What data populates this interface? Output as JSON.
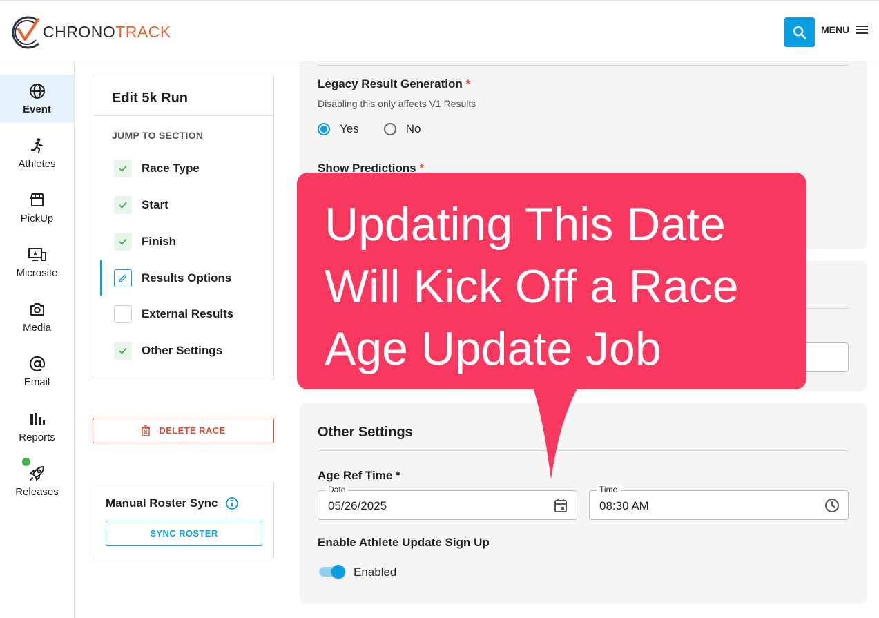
{
  "brand": {
    "chrono": "CHRONO",
    "track": "TRACK",
    "accent": "#e8642a"
  },
  "header": {
    "menu_label": "MENU"
  },
  "colors": {
    "primary": "#0a9fe2",
    "danger": "#e04a3a",
    "success": "#3cb54a",
    "callout": "#f8385f"
  },
  "sidebar": {
    "items": [
      {
        "label": "Event",
        "icon": "globe-icon",
        "active": true
      },
      {
        "label": "Athletes",
        "icon": "runner-icon"
      },
      {
        "label": "PickUp",
        "icon": "store-icon"
      },
      {
        "label": "Microsite",
        "icon": "monitor-star-icon"
      },
      {
        "label": "Media",
        "icon": "camera-icon"
      },
      {
        "label": "Email",
        "icon": "at-icon"
      },
      {
        "label": "Reports",
        "icon": "bar-chart-icon"
      },
      {
        "label": "Releases",
        "icon": "rocket-icon"
      }
    ]
  },
  "jump": {
    "title": "Edit 5k Run",
    "subtitle": "JUMP TO SECTION",
    "items": [
      {
        "label": "Race Type",
        "state": "done"
      },
      {
        "label": "Start",
        "state": "done"
      },
      {
        "label": "Finish",
        "state": "done"
      },
      {
        "label": "Results Options",
        "state": "editing"
      },
      {
        "label": "External Results",
        "state": "empty"
      },
      {
        "label": "Other Settings",
        "state": "done"
      }
    ]
  },
  "delete_label": "DELETE RACE",
  "sync": {
    "title": "Manual Roster Sync",
    "button": "SYNC ROSTER"
  },
  "legacy": {
    "title": "Legacy Result Generation",
    "required": "*",
    "help": "Disabling this only affects V1 Results",
    "options": [
      "Yes",
      "No"
    ],
    "selected": "Yes"
  },
  "predictions": {
    "title": "Show Predictions",
    "required": "*"
  },
  "other": {
    "title": "Other Settings",
    "age_ref_label": "Age Ref Time *",
    "date_label": "Date",
    "date_value": "05/26/2025",
    "time_label": "Time",
    "time_value": "08:30 AM",
    "signup_title": "Enable Athlete Update Sign Up",
    "toggle_label": "Enabled",
    "toggle_on": true
  },
  "callout": {
    "line1": "Updating This Date",
    "line2": "Will Kick Off a Race",
    "line3": "Age Update Job"
  }
}
